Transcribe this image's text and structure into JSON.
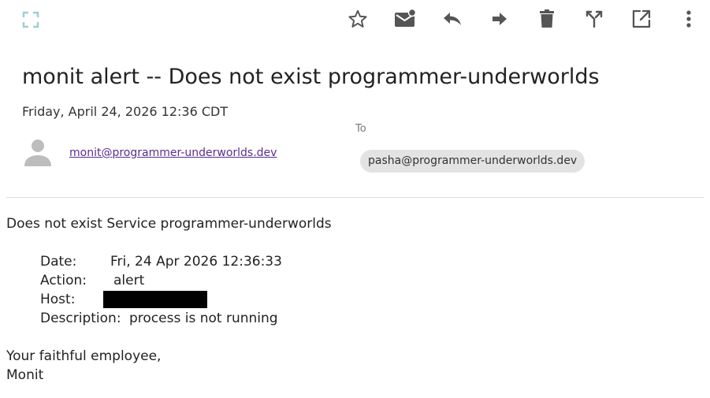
{
  "toolbar": {
    "icons": [
      "expand-icon",
      "star-icon",
      "mark-unread-icon",
      "reply-icon",
      "forward-icon",
      "delete-icon",
      "move-icon",
      "open-external-icon",
      "more-icon"
    ]
  },
  "message": {
    "subject": "monit alert -- Does not exist programmer-underworlds",
    "date": "Friday, April 24, 2026 12:36 CDT",
    "sender": "monit@programmer-underworlds.dev",
    "to_label": "To",
    "recipient": "pasha@programmer-underworlds.dev"
  },
  "body": {
    "intro": "Does not exist Service programmer-underworlds",
    "date_label": "Date:",
    "date_value": "Fri, 24 Apr 2026 12:36:33",
    "action_label": "Action:",
    "action_value": "alert",
    "host_label": "Host:",
    "description_label": "Description:",
    "description_value": "process is not running",
    "closing": "Your faithful employee,",
    "signature": "Monit"
  },
  "colors": {
    "icon": "#555555",
    "expand_icon": "#9fcfcf",
    "link": "#5b2c91",
    "chip_bg": "#e3e3e3"
  }
}
